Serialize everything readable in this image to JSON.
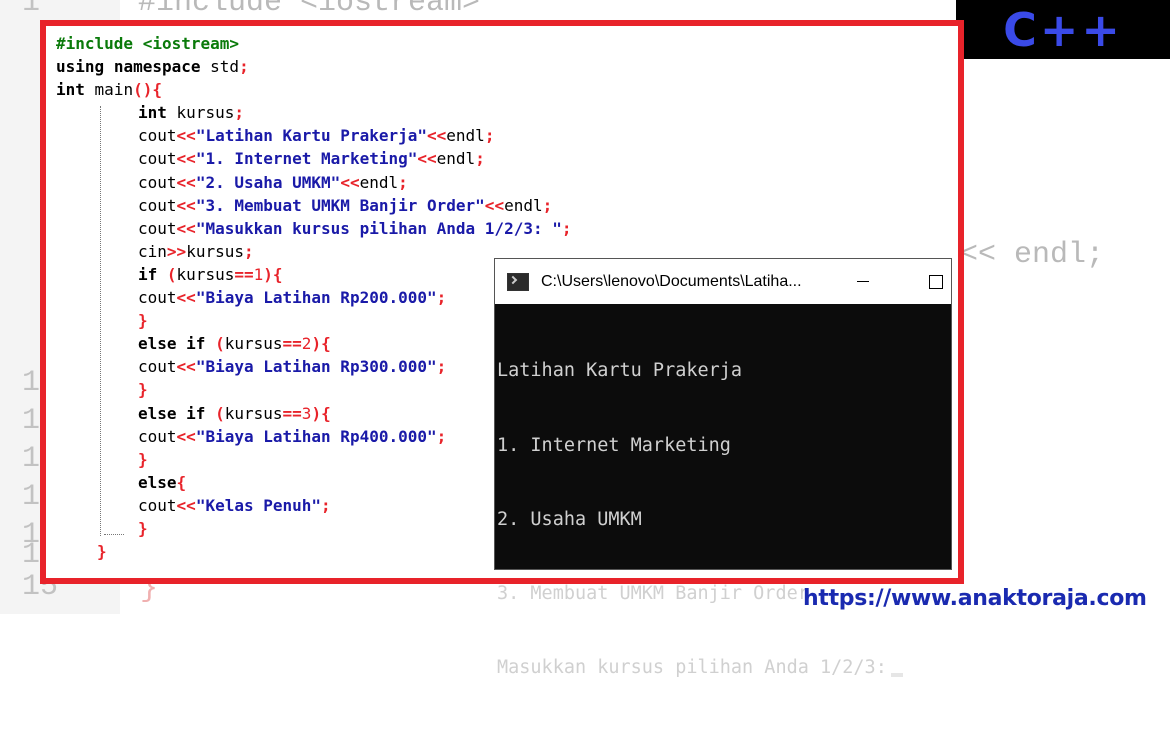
{
  "background_editor": {
    "top_line_number": "1",
    "top_line_code": "#include <iostream>",
    "right_fragment": "<< endl;",
    "line_numbers": [
      "1",
      "1",
      "1",
      "1",
      "1",
      "1",
      "15"
    ],
    "bottom_brace": "}"
  },
  "badge": {
    "label": "C++"
  },
  "code": {
    "lines": [
      "#include <iostream>",
      "using namespace std;",
      "int main(){",
      "int kursus;",
      "cout<<\"Latihan Kartu Prakerja\"<<endl;",
      "cout<<\"1. Internet Marketing\"<<endl;",
      "cout<<\"2. Usaha UMKM\"<<endl;",
      "cout<<\"3. Membuat UMKM Banjir Order\"<<endl;",
      "cout<<\"Masukkan kursus pilihan Anda 1/2/3: \";",
      "cin>>kursus;",
      "if (kursus==1){",
      "cout<<\"Biaya Latihan Rp200.000\";",
      "}",
      "else if (kursus==2){",
      "cout<<\"Biaya Latihan Rp300.000\";",
      "}",
      "else if (kursus==3){",
      "cout<<\"Biaya Latihan Rp400.000\";",
      "}",
      "else{",
      "cout<<\"Kelas Penuh\";",
      "}",
      "}"
    ]
  },
  "console": {
    "title": "C:\\Users\\lenovo\\Documents\\Latiha...",
    "output": [
      "Latihan Kartu Prakerja",
      "1. Internet Marketing",
      "2. Usaha UMKM",
      "3. Membuat UMKM Banjir Order",
      "Masukkan kursus pilihan Anda 1/2/3:"
    ]
  },
  "footer": {
    "url": "https://www.anaktoraja.com"
  },
  "colors": {
    "frame": "#e8232a",
    "badge_text": "#3a4ae8",
    "url": "#1a2ab0",
    "string": "#1a1aa8",
    "preprocessor": "#0a7a0a"
  }
}
